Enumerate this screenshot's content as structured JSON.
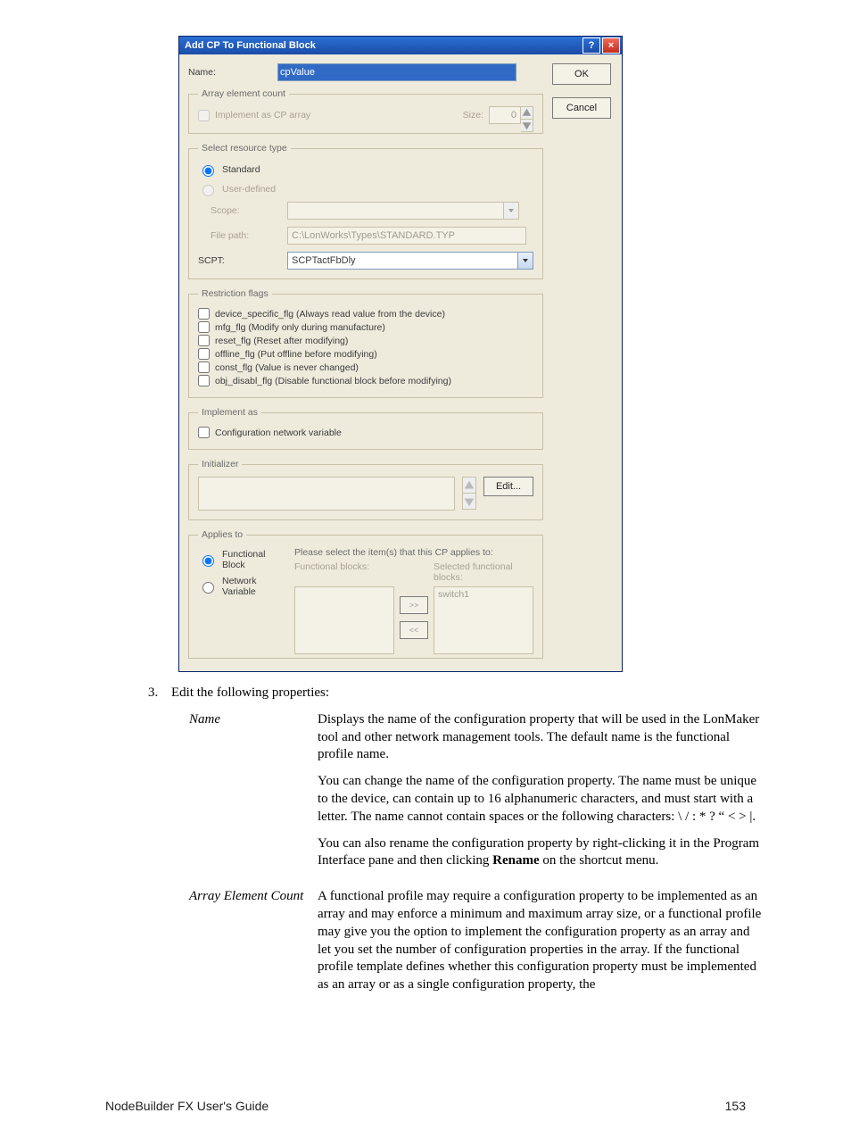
{
  "dialog": {
    "title": "Add CP To Functional Block",
    "ok": "OK",
    "cancel": "Cancel",
    "name_label": "Name:",
    "name_value": "cpValue",
    "group_array": {
      "legend": "Array element count",
      "check_impl": "Implement as CP array",
      "size_label": "Size:",
      "size_value": "0"
    },
    "group_res": {
      "legend": "Select resource type",
      "radio_std": "Standard",
      "radio_user": "User-defined",
      "scope_label": "Scope:",
      "scope_value": "",
      "filepath_label": "File path:",
      "filepath_value": "C:\\LonWorks\\Types\\STANDARD.TYP",
      "scpt_label": "SCPT:",
      "scpt_value": "SCPTactFbDly"
    },
    "group_flags": {
      "legend": "Restriction flags",
      "f1": "device_specific_flg  (Always read value from the device)",
      "f2": "mfg_flg  (Modify only during manufacture)",
      "f3": "reset_flg  (Reset after modifying)",
      "f4": "offline_flg  (Put offline before modifying)",
      "f5": "const_flg  (Value is never changed)",
      "f6": "obj_disabl_flg  (Disable functional block before modifying)"
    },
    "group_impl": {
      "legend": "Implement as",
      "check": "Configuration network variable"
    },
    "group_init": {
      "legend": "Initializer",
      "edit": "Edit..."
    },
    "group_applies": {
      "legend": "Applies to",
      "radio_fb": "Functional Block",
      "radio_nv": "Network Variable",
      "instruction": "Please select the item(s) that this CP applies to:",
      "left_label": "Functional blocks:",
      "right_label": "Selected functional blocks:",
      "right_item": "switch1",
      "move_r": ">>",
      "move_l": "<<"
    }
  },
  "doc": {
    "step_num": "3.",
    "step_text": "Edit the following properties:",
    "props": {
      "name": {
        "title": "Name",
        "p1a": "Displays the name of the configuration property that will be used in the LonMaker tool and other network management tools.   The default name is the functional profile name.",
        "p2": "You can change the name of the configuration property.  The name must be unique to the device, can contain up to 16 alphanumeric characters, and must start with a letter.  The name cannot contain spaces or the following characters: \\ / : * ? “ < > |.",
        "p3a": "You can also rename the configuration property by right-clicking it in the Program Interface pane and then clicking ",
        "p3b": "Rename",
        "p3c": " on the shortcut menu."
      },
      "aec": {
        "title": "Array Element Count",
        "p1": "A functional profile may require a configuration property to be implemented as an array and may enforce a minimum and maximum array size, or a functional profile may give you the option to implement the configuration property as an array and let you set the number of configuration properties in the array.  If the functional profile template defines whether this configuration property must be implemented as an array or as a single configuration property, the"
      }
    }
  },
  "footer": {
    "left": "NodeBuilder FX User's Guide",
    "right": "153"
  }
}
